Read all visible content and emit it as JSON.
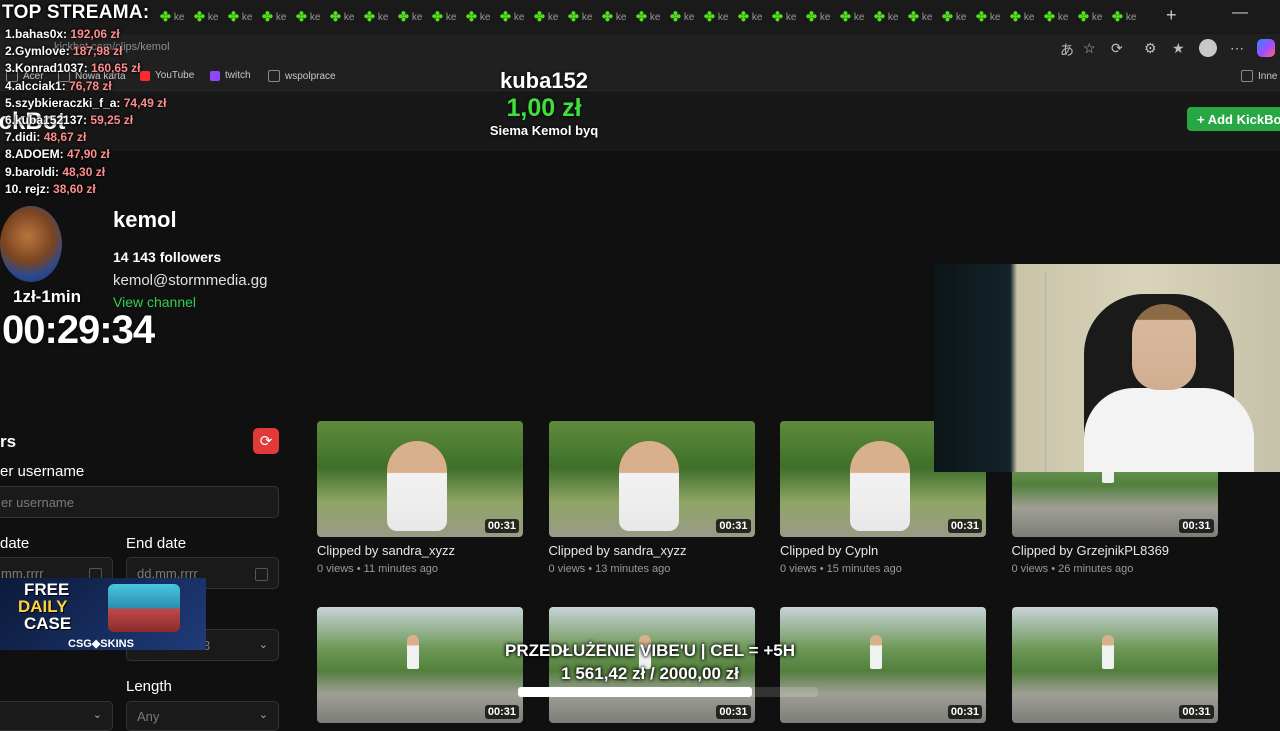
{
  "browser": {
    "tab_label": "ke",
    "url": "kickbot.com/clips/kemol",
    "bookmarks": [
      {
        "label": "Acer",
        "color": "#8a8a8a"
      },
      {
        "label": "Nowa karta",
        "color": "#8a8a8a"
      },
      {
        "label": "YouTube",
        "color": "#ff2a2a"
      },
      {
        "label": "twitch",
        "color": "#9146ff"
      },
      {
        "label": "wspolprace",
        "color": "#8a8a8a"
      }
    ],
    "other_bookmarks": "Inne"
  },
  "page": {
    "logo": "ickBot",
    "add_button": "+ Add KickBot"
  },
  "channel": {
    "name": "kemol",
    "followers": "14 143 followers",
    "email": "kemol@stormmedia.gg",
    "view_channel": "View channel"
  },
  "filters": {
    "title": "rs",
    "username_label": "er username",
    "username_placeholder": "er username",
    "start_label": "date",
    "start_value": "mm.rrrr",
    "end_label": "End date",
    "end_value": "dd.mm.rrrr",
    "sort_value": "3",
    "length_label": "Length",
    "length_value": "Any"
  },
  "clips": [
    {
      "title": "Clipped by sandra_xyzz",
      "meta": "0 views • 11 minutes ago",
      "duration": "00:31",
      "scene": "sit"
    },
    {
      "title": "Clipped by sandra_xyzz",
      "meta": "0 views • 13 minutes ago",
      "duration": "00:31",
      "scene": "sit"
    },
    {
      "title": "Clipped by Cypln",
      "meta": "0 views • 15 minutes ago",
      "duration": "00:31",
      "scene": "sit"
    },
    {
      "title": "Clipped by GrzejnikPL8369",
      "meta": "0 views • 26 minutes ago",
      "duration": "00:31",
      "scene": "park"
    },
    {
      "title": "",
      "meta": "",
      "duration": "00:31",
      "scene": "park"
    },
    {
      "title": "",
      "meta": "",
      "duration": "00:31",
      "scene": "park"
    },
    {
      "title": "",
      "meta": "",
      "duration": "00:31",
      "scene": "park"
    },
    {
      "title": "",
      "meta": "",
      "duration": "00:31",
      "scene": "park"
    }
  ],
  "overlay": {
    "leaderboard_title": "TOP STREAMA:",
    "leaderboard": [
      {
        "name": "1.bahas0x:",
        "amount": "192,06 zł"
      },
      {
        "name": "2.Gymlove:",
        "amount": "187,98 zł"
      },
      {
        "name": "3.Konrad1037:",
        "amount": "160,65 zł"
      },
      {
        "name": "4.alcciak1:",
        "amount": "76,78 zł"
      },
      {
        "name": "5.szybkieraczki_f_a:",
        "amount": "74,49 zł"
      },
      {
        "name": "6.kuba152137:",
        "amount": "59,25 zł"
      },
      {
        "name": "7.didi:",
        "amount": "48,67 zł"
      },
      {
        "name": "8.ADOEM:",
        "amount": "47,90 zł"
      },
      {
        "name": "9.baroldi:",
        "amount": "48,30 zł"
      },
      {
        "name": "10. rejz:",
        "amount": "38,60 zł"
      }
    ],
    "donation": {
      "donor": "kuba152",
      "amount": "1,00 zł",
      "message": "Siema Kemol byq"
    },
    "rate": "1zł-1min",
    "timer": "00:29:34",
    "promo": {
      "free": "FREE",
      "daily": "DAILY",
      "case": "CASE",
      "brand": "CSG◆SKINS"
    },
    "goal": {
      "title": "PRZEDŁUŻENIE VIBE'U | CEL = +5H",
      "amount": "1 561,42 zł / 2000,00 zł",
      "progress": 0.78
    }
  }
}
